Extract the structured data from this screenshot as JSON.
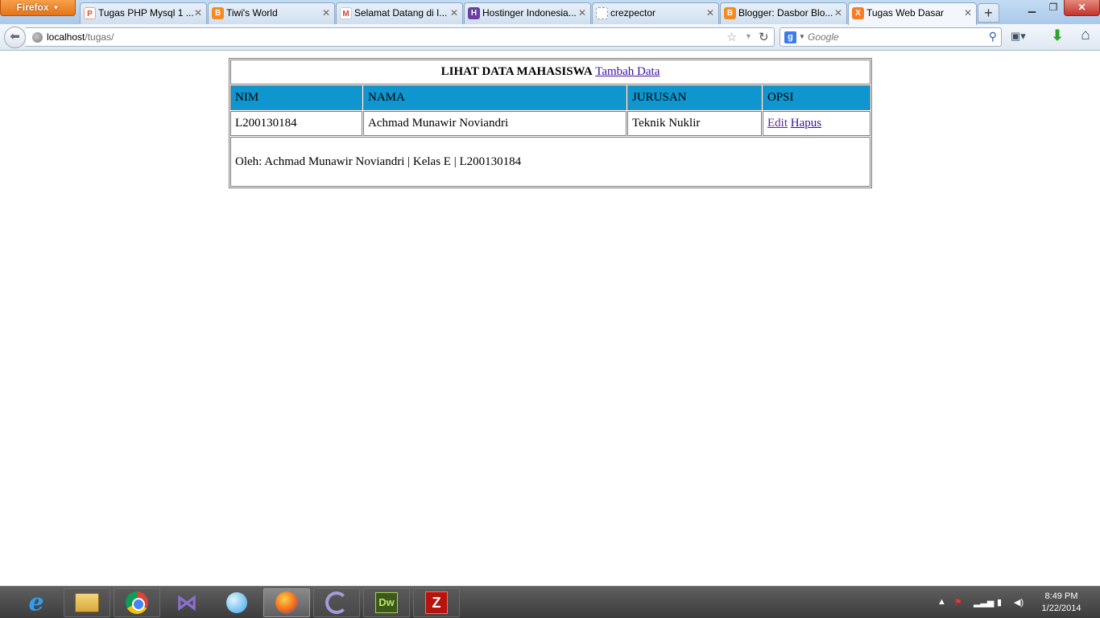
{
  "browser": {
    "menu_button_label": "Firefox",
    "tabs": [
      {
        "title": "Tugas PHP Mysql 1 ...",
        "favicon": "php-icon",
        "active": false
      },
      {
        "title": "Tiwi's World",
        "favicon": "blogger-icon",
        "active": false
      },
      {
        "title": "Selamat Datang di I...",
        "favicon": "gmail-icon",
        "active": false
      },
      {
        "title": "Hostinger Indonesia...",
        "favicon": "hostinger-icon",
        "active": false
      },
      {
        "title": "crezpector",
        "favicon": "blank-page-icon",
        "active": false
      },
      {
        "title": "Blogger: Dasbor Blo...",
        "favicon": "blogger-icon",
        "active": false
      },
      {
        "title": "Tugas Web Dasar",
        "favicon": "xampp-icon",
        "active": true
      }
    ],
    "url": {
      "host": "localhost",
      "path": "/tugas/"
    },
    "search": {
      "engine_icon": "google-icon",
      "placeholder": "Google"
    }
  },
  "page": {
    "table": {
      "title": "LIHAT DATA MAHASISWA",
      "add_link": "Tambah Data",
      "headers": [
        "NIM",
        "NAMA",
        "JURUSAN",
        "OPSI"
      ],
      "rows": [
        {
          "nim": "L200130184",
          "nama": "Achmad Munawir Noviandri",
          "jurusan": "Teknik Nuklir",
          "edit": "Edit",
          "hapus": "Hapus"
        }
      ],
      "footer": "Oleh: Achmad Munawir Noviandri | Kelas E | L200130184"
    },
    "colors": {
      "header_bg": "#0f96cf",
      "link": "#3a0fa0"
    }
  },
  "taskbar": {
    "apps": [
      "internet-explorer-icon",
      "file-explorer-icon",
      "chrome-icon",
      "visual-studio-icon",
      "bird-app-icon",
      "firefox-icon",
      "spiral-app-icon",
      "dreamweaver-icon",
      "filezilla-icon"
    ],
    "dreamweaver_label": "Dw",
    "clock": {
      "time": "8:49 PM",
      "date": "1/22/2014"
    }
  }
}
